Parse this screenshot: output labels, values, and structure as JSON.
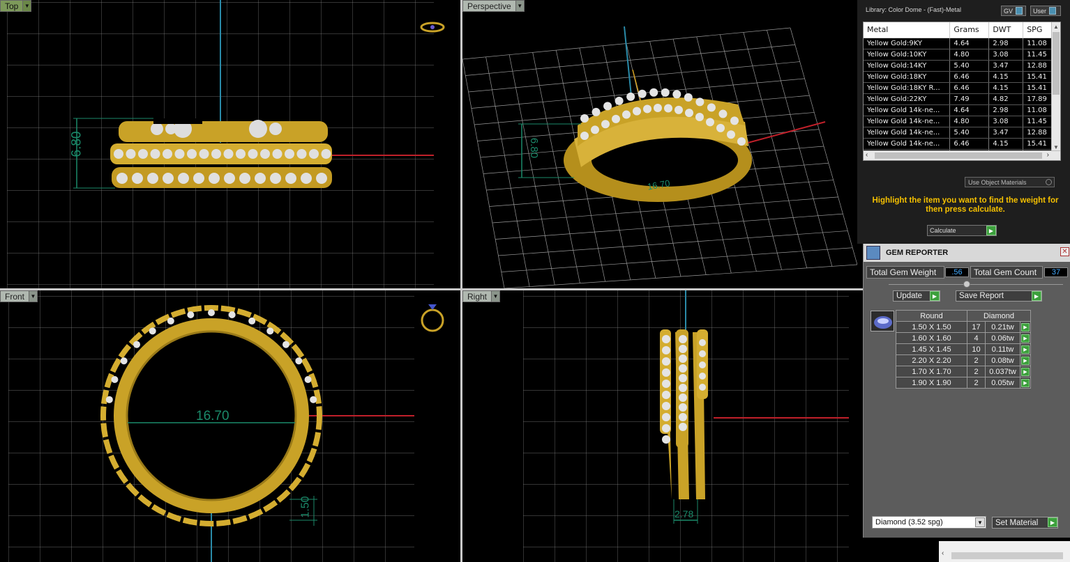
{
  "viewports": {
    "top": {
      "label": "Top",
      "dim": "6.80"
    },
    "perspective": {
      "label": "Perspective",
      "dim1": "6.80",
      "dim2": "16.70"
    },
    "front": {
      "label": "Front",
      "dim1": "16.70",
      "dim2": "1.50"
    },
    "right": {
      "label": "Right",
      "dim": "2.78"
    }
  },
  "material_panel": {
    "library_title": "Library: Color Dome - (Fast)-Metal",
    "gv_label": "GV",
    "user_label": "User",
    "columns": [
      "Metal",
      "Grams",
      "DWT",
      "SPG"
    ],
    "rows": [
      [
        "Yellow Gold:9KY",
        "4.64",
        "2.98",
        "11.08"
      ],
      [
        "Yellow Gold:10KY",
        "4.80",
        "3.08",
        "11.45"
      ],
      [
        "Yellow Gold:14KY",
        "5.40",
        "3.47",
        "12.88"
      ],
      [
        "Yellow Gold:18KY",
        "6.46",
        "4.15",
        "15.41"
      ],
      [
        "Yellow Gold:18KY R...",
        "6.46",
        "4.15",
        "15.41"
      ],
      [
        "Yellow Gold:22KY",
        "7.49",
        "4.82",
        "17.89"
      ],
      [
        "Yellow Gold 14k-ne...",
        "4.64",
        "2.98",
        "11.08"
      ],
      [
        "Yellow Gold 14k-ne...",
        "4.80",
        "3.08",
        "11.45"
      ],
      [
        "Yellow Gold 14k-ne...",
        "5.40",
        "3.47",
        "12.88"
      ],
      [
        "Yellow Gold 14k-ne...",
        "6.46",
        "4.15",
        "15.41"
      ],
      [
        "Yellow Gold 14k-ne...",
        "6.46",
        "4.15",
        "15.41"
      ]
    ],
    "use_object_materials": "Use Object Materials",
    "hint": "Highlight the item you want to find the weight for then press calculate.",
    "calculate_label": "Calculate"
  },
  "gem_reporter": {
    "title": "GEM REPORTER",
    "total_weight_label": "Total Gem Weight",
    "total_weight_value": ".56",
    "total_count_label": "Total Gem Count",
    "total_count_value": "37",
    "update_label": "Update",
    "save_report_label": "Save Report",
    "shape_header": "Round",
    "material_header": "Diamond",
    "gems": [
      [
        "1.50 X 1.50",
        "17",
        "0.21tw"
      ],
      [
        "1.60 X 1.60",
        "4",
        "0.06tw"
      ],
      [
        "1.45 X 1.45",
        "10",
        "0.11tw"
      ],
      [
        "2.20 X 2.20",
        "2",
        "0.08tw"
      ],
      [
        "1.70 X 1.70",
        "2",
        "0.037tw"
      ],
      [
        "1.90 X 1.90",
        "2",
        "0.05tw"
      ]
    ],
    "material_select": "Diamond     (3.52 spg)",
    "set_material_label": "Set Material"
  },
  "colors": {
    "gold": "#c9a227",
    "grid": "#9a9a9a",
    "axis_red": "#c0202a",
    "axis_blue": "#2a8aa8",
    "dim_green": "#1b8a6a",
    "hint_yellow": "#f5c000"
  }
}
